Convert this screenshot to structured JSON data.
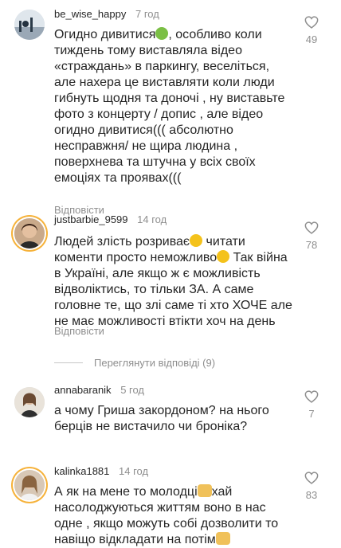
{
  "comments": [
    {
      "username": "be_wise_happy",
      "time": "7 год",
      "lines": [
        "Огидно  дивитися",
        ", особливо коли",
        "тиждень тому виставляла відео",
        "«страждань» в паркингу,  веселіться,",
        "але нахера це виставляти коли люди",
        "гибнуть щодня та доночі , ну виставьте",
        "фото з концерту / допис , але відео",
        "огидно дивитися((( абсолютно",
        "несправжня/ не щира людина ,",
        "поверхнева та штучна у всіх своїх",
        "емоціях та проявах((("
      ],
      "likes": "49",
      "reply_label": "Відповісти"
    },
    {
      "username": "justbarbie_9599",
      "time": "14 год",
      "lines": [
        "Людей злість розриває",
        " читати",
        "коменти просто неможливо",
        " Так війна",
        "в Україні, але якщо ж є можливість",
        "відволіктись, то тільки ЗА. А саме",
        "головне те, що злі саме ті хто ХОЧЕ але",
        "не має можливості втікти хоч на день"
      ],
      "likes": "78",
      "reply_label": "Відповісти"
    },
    {
      "username": "annabaranik",
      "time": "5 год",
      "lines": [
        "а чому Гриша закордоном? на нього",
        "берців не вистачило чи броніка?"
      ],
      "likes": "7",
      "reply_label": ""
    },
    {
      "username": "kalinka1881",
      "time": "14 год",
      "lines": [
        "А як на мене то молодці",
        "хай",
        "насолоджуються життям воно в нас",
        "одне , якщо можуть собі дозволити то",
        "навіщо відкладати на потім"
      ],
      "likes": "83",
      "reply_label": ""
    }
  ],
  "view_replies_label": "Переглянути відповіді (9)",
  "colors": {
    "ring": "#f6b23a",
    "muted": "#8e8e8e",
    "text": "#262626"
  },
  "icons": {
    "like": "heart-outline-icon"
  }
}
